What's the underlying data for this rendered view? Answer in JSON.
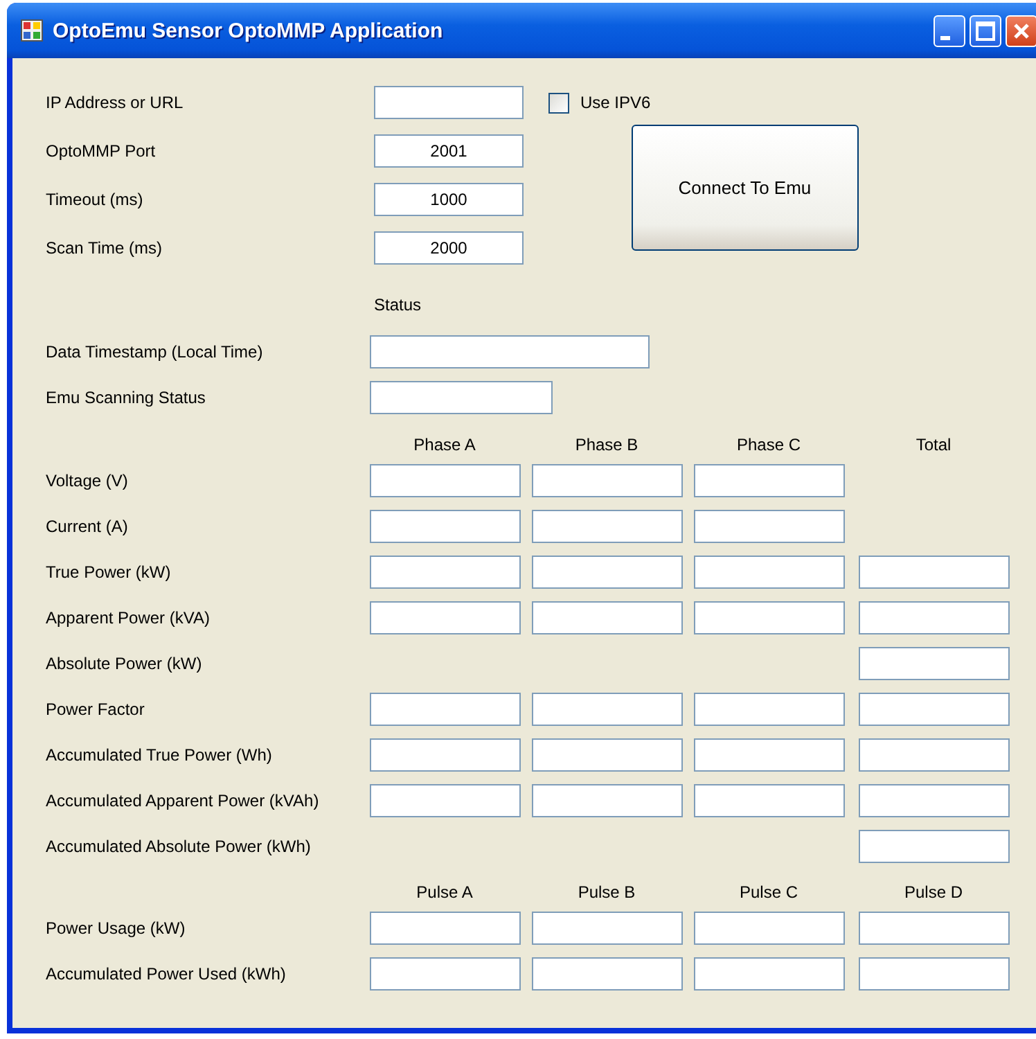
{
  "window": {
    "title": "OptoEmu Sensor OptoMMP Application"
  },
  "connection": [
    {
      "label": "IP Address or URL"
    },
    {
      "label": "OptoMMP Port",
      "value": "2001"
    },
    {
      "label": "Timeout (ms)",
      "value": "1000"
    },
    {
      "label": "Scan Time (ms)",
      "value": "2000"
    }
  ],
  "use_ipv6": {
    "label": "Use IPV6",
    "checked": false
  },
  "connect_button": "Connect To Emu",
  "status": {
    "heading": "Status",
    "rows": [
      {
        "label": "Data Timestamp (Local Time)",
        "kind": "wide"
      },
      {
        "label": "Emu Scanning Status",
        "kind": "narrow"
      }
    ]
  },
  "power_table": {
    "columns": [
      "Phase A",
      "Phase B",
      "Phase C",
      "Total"
    ],
    "rows": [
      {
        "label": "Voltage (V)",
        "kind": "phases"
      },
      {
        "label": "Current (A)",
        "kind": "phases"
      },
      {
        "label": "True Power (kW)",
        "kind": "all"
      },
      {
        "label": "Apparent Power (kVA)",
        "kind": "all"
      },
      {
        "label": "Absolute Power (kW)",
        "kind": "total"
      },
      {
        "label": "Power Factor",
        "kind": "all"
      },
      {
        "label": "Accumulated True Power (Wh)",
        "kind": "all"
      },
      {
        "label": "Accumulated Apparent Power (kVAh)",
        "kind": "all"
      },
      {
        "label": "Accumulated Absolute Power (kWh)",
        "kind": "total"
      }
    ]
  },
  "pulse_table": {
    "columns": [
      "Pulse A",
      "Pulse B",
      "Pulse C",
      "Pulse D"
    ],
    "rows": [
      {
        "label": "Power Usage (kW)",
        "kind": "all"
      },
      {
        "label": "Accumulated Power Used (kWh)",
        "kind": "all"
      }
    ]
  }
}
